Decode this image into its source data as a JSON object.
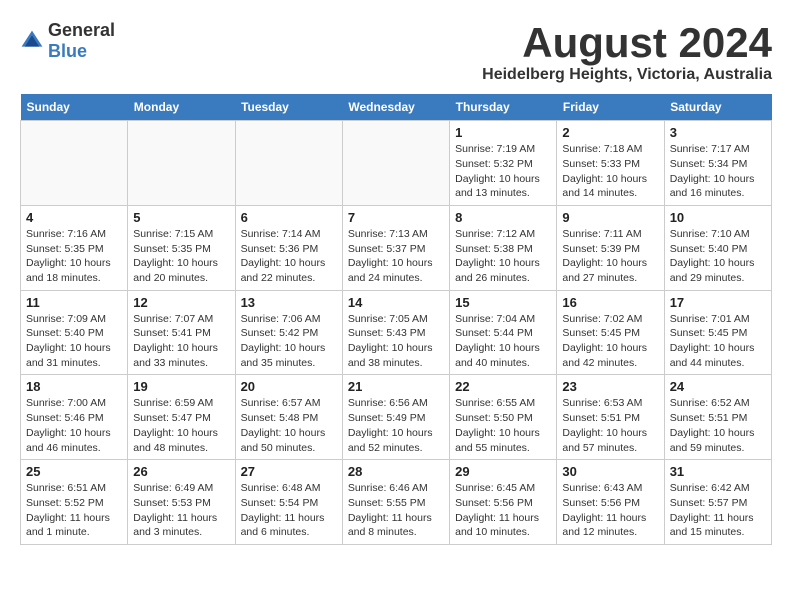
{
  "header": {
    "logo_general": "General",
    "logo_blue": "Blue",
    "month": "August 2024",
    "location": "Heidelberg Heights, Victoria, Australia"
  },
  "days_of_week": [
    "Sunday",
    "Monday",
    "Tuesday",
    "Wednesday",
    "Thursday",
    "Friday",
    "Saturday"
  ],
  "weeks": [
    [
      {
        "day": "",
        "info": ""
      },
      {
        "day": "",
        "info": ""
      },
      {
        "day": "",
        "info": ""
      },
      {
        "day": "",
        "info": ""
      },
      {
        "day": "1",
        "info": "Sunrise: 7:19 AM\nSunset: 5:32 PM\nDaylight: 10 hours\nand 13 minutes."
      },
      {
        "day": "2",
        "info": "Sunrise: 7:18 AM\nSunset: 5:33 PM\nDaylight: 10 hours\nand 14 minutes."
      },
      {
        "day": "3",
        "info": "Sunrise: 7:17 AM\nSunset: 5:34 PM\nDaylight: 10 hours\nand 16 minutes."
      }
    ],
    [
      {
        "day": "4",
        "info": "Sunrise: 7:16 AM\nSunset: 5:35 PM\nDaylight: 10 hours\nand 18 minutes."
      },
      {
        "day": "5",
        "info": "Sunrise: 7:15 AM\nSunset: 5:35 PM\nDaylight: 10 hours\nand 20 minutes."
      },
      {
        "day": "6",
        "info": "Sunrise: 7:14 AM\nSunset: 5:36 PM\nDaylight: 10 hours\nand 22 minutes."
      },
      {
        "day": "7",
        "info": "Sunrise: 7:13 AM\nSunset: 5:37 PM\nDaylight: 10 hours\nand 24 minutes."
      },
      {
        "day": "8",
        "info": "Sunrise: 7:12 AM\nSunset: 5:38 PM\nDaylight: 10 hours\nand 26 minutes."
      },
      {
        "day": "9",
        "info": "Sunrise: 7:11 AM\nSunset: 5:39 PM\nDaylight: 10 hours\nand 27 minutes."
      },
      {
        "day": "10",
        "info": "Sunrise: 7:10 AM\nSunset: 5:40 PM\nDaylight: 10 hours\nand 29 minutes."
      }
    ],
    [
      {
        "day": "11",
        "info": "Sunrise: 7:09 AM\nSunset: 5:40 PM\nDaylight: 10 hours\nand 31 minutes."
      },
      {
        "day": "12",
        "info": "Sunrise: 7:07 AM\nSunset: 5:41 PM\nDaylight: 10 hours\nand 33 minutes."
      },
      {
        "day": "13",
        "info": "Sunrise: 7:06 AM\nSunset: 5:42 PM\nDaylight: 10 hours\nand 35 minutes."
      },
      {
        "day": "14",
        "info": "Sunrise: 7:05 AM\nSunset: 5:43 PM\nDaylight: 10 hours\nand 38 minutes."
      },
      {
        "day": "15",
        "info": "Sunrise: 7:04 AM\nSunset: 5:44 PM\nDaylight: 10 hours\nand 40 minutes."
      },
      {
        "day": "16",
        "info": "Sunrise: 7:02 AM\nSunset: 5:45 PM\nDaylight: 10 hours\nand 42 minutes."
      },
      {
        "day": "17",
        "info": "Sunrise: 7:01 AM\nSunset: 5:45 PM\nDaylight: 10 hours\nand 44 minutes."
      }
    ],
    [
      {
        "day": "18",
        "info": "Sunrise: 7:00 AM\nSunset: 5:46 PM\nDaylight: 10 hours\nand 46 minutes."
      },
      {
        "day": "19",
        "info": "Sunrise: 6:59 AM\nSunset: 5:47 PM\nDaylight: 10 hours\nand 48 minutes."
      },
      {
        "day": "20",
        "info": "Sunrise: 6:57 AM\nSunset: 5:48 PM\nDaylight: 10 hours\nand 50 minutes."
      },
      {
        "day": "21",
        "info": "Sunrise: 6:56 AM\nSunset: 5:49 PM\nDaylight: 10 hours\nand 52 minutes."
      },
      {
        "day": "22",
        "info": "Sunrise: 6:55 AM\nSunset: 5:50 PM\nDaylight: 10 hours\nand 55 minutes."
      },
      {
        "day": "23",
        "info": "Sunrise: 6:53 AM\nSunset: 5:51 PM\nDaylight: 10 hours\nand 57 minutes."
      },
      {
        "day": "24",
        "info": "Sunrise: 6:52 AM\nSunset: 5:51 PM\nDaylight: 10 hours\nand 59 minutes."
      }
    ],
    [
      {
        "day": "25",
        "info": "Sunrise: 6:51 AM\nSunset: 5:52 PM\nDaylight: 11 hours\nand 1 minute."
      },
      {
        "day": "26",
        "info": "Sunrise: 6:49 AM\nSunset: 5:53 PM\nDaylight: 11 hours\nand 3 minutes."
      },
      {
        "day": "27",
        "info": "Sunrise: 6:48 AM\nSunset: 5:54 PM\nDaylight: 11 hours\nand 6 minutes."
      },
      {
        "day": "28",
        "info": "Sunrise: 6:46 AM\nSunset: 5:55 PM\nDaylight: 11 hours\nand 8 minutes."
      },
      {
        "day": "29",
        "info": "Sunrise: 6:45 AM\nSunset: 5:56 PM\nDaylight: 11 hours\nand 10 minutes."
      },
      {
        "day": "30",
        "info": "Sunrise: 6:43 AM\nSunset: 5:56 PM\nDaylight: 11 hours\nand 12 minutes."
      },
      {
        "day": "31",
        "info": "Sunrise: 6:42 AM\nSunset: 5:57 PM\nDaylight: 11 hours\nand 15 minutes."
      }
    ]
  ]
}
